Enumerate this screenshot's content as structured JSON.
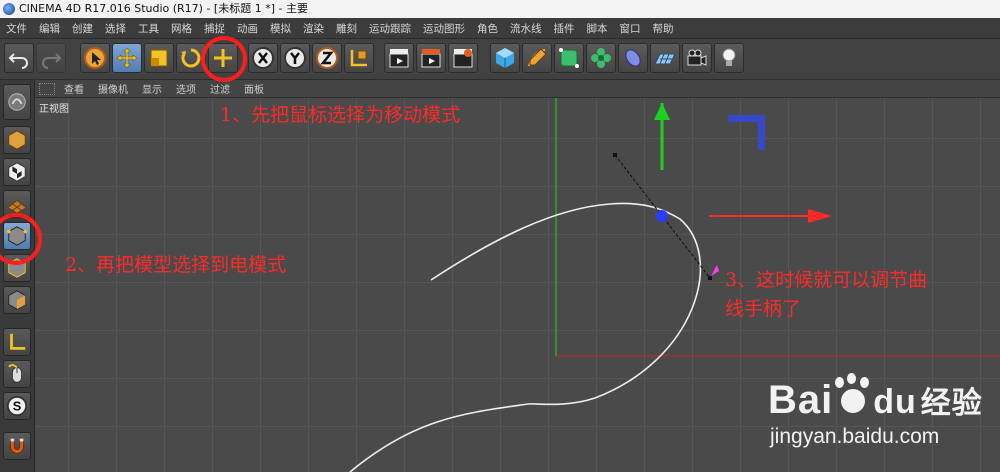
{
  "window": {
    "title": "CINEMA 4D R17.016 Studio (R17) - [未标题 1 *] - 主要"
  },
  "menubar": {
    "items": [
      "文件",
      "编辑",
      "创建",
      "选择",
      "工具",
      "网格",
      "捕捉",
      "动画",
      "模拟",
      "渲染",
      "雕刻",
      "运动跟踪",
      "运动图形",
      "角色",
      "流水线",
      "插件",
      "脚本",
      "窗口",
      "帮助"
    ]
  },
  "toolbar": {
    "active_tool": "move"
  },
  "viewport": {
    "menu": [
      "查看",
      "摄像机",
      "显示",
      "选项",
      "过滤",
      "面板"
    ],
    "label": "正视图"
  },
  "annotations": {
    "step1": "1、先把鼠标选择为移动模式",
    "step2": "2、再把模型选择到电模式",
    "step3_line1": "3、这时候就可以调节曲",
    "step3_line2": "线手柄了"
  },
  "watermark": {
    "brand_bai": "Bai",
    "brand_du": "du",
    "brand_cn": "经验",
    "url": "jingyan.baidu.com"
  },
  "colors": {
    "annotation": "#ff2a2a",
    "y_axis": "#1fd11f",
    "x_axis": "#ff2a2a",
    "point_handle": "#2a3cff",
    "active_blue": "#5a88c4"
  }
}
